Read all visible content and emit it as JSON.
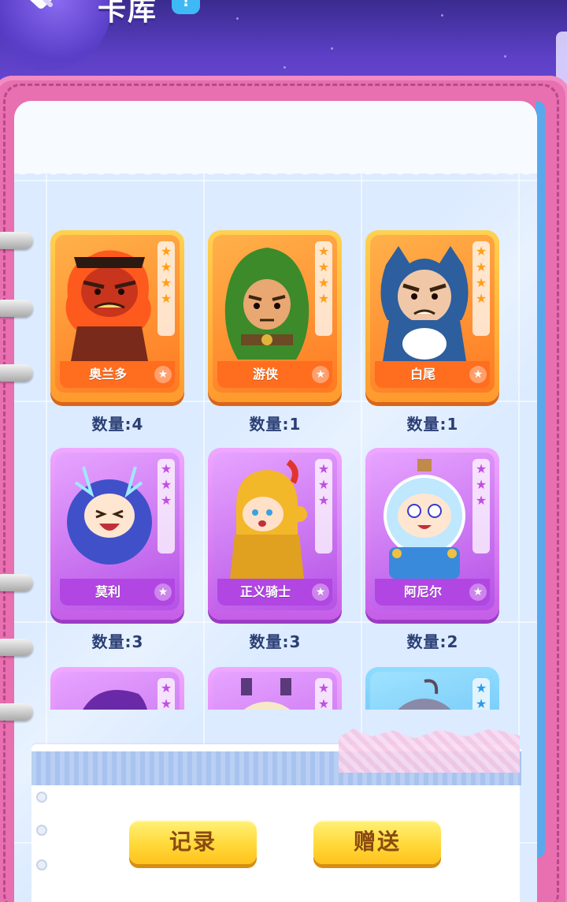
{
  "header": {
    "title": "卡库",
    "help": "!"
  },
  "cards": [
    {
      "name": "奥兰多",
      "quantity_label": "数量:",
      "quantity": "4",
      "rarity": "orange",
      "stars": 4
    },
    {
      "name": "游侠",
      "quantity_label": "数量:",
      "quantity": "1",
      "rarity": "orange",
      "stars": 4
    },
    {
      "name": "白尾",
      "quantity_label": "数量:",
      "quantity": "1",
      "rarity": "orange",
      "stars": 4
    },
    {
      "name": "莫利",
      "quantity_label": "数量:",
      "quantity": "3",
      "rarity": "purple",
      "stars": 3
    },
    {
      "name": "正义骑士",
      "quantity_label": "数量:",
      "quantity": "3",
      "rarity": "purple",
      "stars": 3
    },
    {
      "name": "阿尼尔",
      "quantity_label": "数量:",
      "quantity": "2",
      "rarity": "purple",
      "stars": 3
    },
    {
      "name": "",
      "rarity": "purple",
      "stars": 2
    },
    {
      "name": "",
      "rarity": "purple",
      "stars": 2
    },
    {
      "name": "",
      "rarity": "blue",
      "stars": 2
    }
  ],
  "buttons": {
    "record": "记录",
    "gift": "赠送"
  },
  "colors": {
    "orange_card": "#ff8a26",
    "purple_card": "#c65ee8",
    "blue_card": "#3fa8f0",
    "button_yellow": "#ffd93a",
    "notebook_pink": "#e86fb0"
  }
}
